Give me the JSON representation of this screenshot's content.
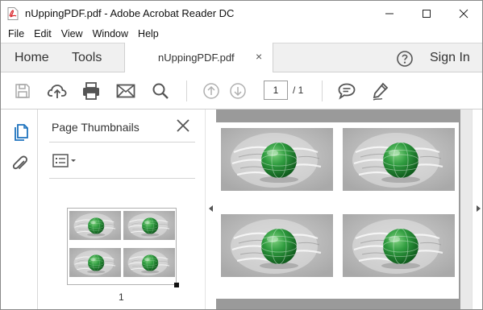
{
  "window": {
    "title": "nUppingPDF.pdf - Adobe Acrobat Reader DC"
  },
  "menu": {
    "items": [
      "File",
      "Edit",
      "View",
      "Window",
      "Help"
    ]
  },
  "tabs": {
    "home": "Home",
    "tools": "Tools",
    "document": "nUppingPDF.pdf",
    "close_glyph": "×",
    "sign_in": "Sign In"
  },
  "toolbar": {
    "current_page": "1",
    "page_of": "/ 1",
    "icons": [
      "save-icon",
      "upload-cloud-icon",
      "print-icon",
      "email-icon",
      "search-icon",
      "page-up-icon",
      "page-down-icon",
      "comment-icon",
      "sign-pen-icon"
    ]
  },
  "sidebar": {
    "panel_title": "Page Thumbnails",
    "thumbnail_label": "1",
    "icons": [
      "page-thumbnails-icon",
      "attachments-icon",
      "thumbnail-options-icon",
      "close-icon"
    ]
  },
  "document": {
    "images": [
      {
        "name": "tutorialspoint-globe-image"
      },
      {
        "name": "tutorialspoint-globe-image"
      },
      {
        "name": "tutorialspoint-globe-image"
      },
      {
        "name": "tutorialspoint-globe-image"
      }
    ]
  },
  "colors": {
    "globe_green": "#2e9b3e",
    "doc_background": "#9a9a9a",
    "pdf_red": "#d9262b"
  }
}
